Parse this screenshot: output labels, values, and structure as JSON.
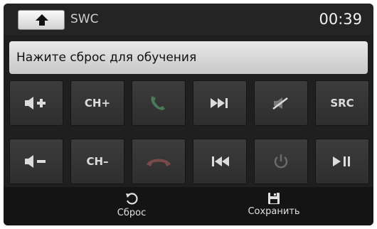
{
  "header": {
    "title": "SWC",
    "clock": "00:39"
  },
  "prompt": {
    "text": "Нажите сброс для обучения"
  },
  "keys": {
    "vol_up": "volume-up-icon",
    "ch_up": "CH+",
    "call": "phone-answer-icon",
    "next": "next-track-icon",
    "mute": "mute-icon",
    "src": "SRC",
    "vol_down": "volume-down-icon",
    "ch_down": "CH–",
    "hangup": "phone-hangup-icon",
    "prev": "previous-track-icon",
    "power": "power-icon",
    "play_pause": "play-pause-icon"
  },
  "bottom": {
    "reset_label": "Сброс",
    "save_label": "Сохранить"
  },
  "colors": {
    "background": "#1f1f1f",
    "key": "#353535",
    "prompt": "#d8d8d8",
    "call_green": "#4a7a5a",
    "hangup_red": "#7a4a4a"
  }
}
